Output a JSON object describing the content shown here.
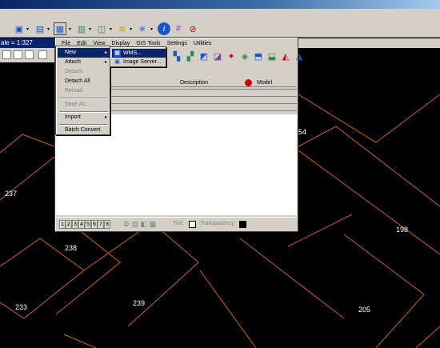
{
  "status": {
    "scale": "ale = 1:327"
  },
  "menubar": [
    "File",
    "Edit",
    "View",
    "Display",
    "GIS Tools",
    "Settings",
    "Utilities"
  ],
  "grid": {
    "col_description": "Description",
    "col_model": "Model"
  },
  "file_menu": {
    "items": [
      {
        "label": "New",
        "state": "selected",
        "submenu": true
      },
      {
        "label": "Attach",
        "state": "enabled",
        "submenu": true
      },
      {
        "label": "Detach",
        "state": "disabled"
      },
      {
        "label": "Detach All",
        "state": "enabled"
      },
      {
        "label": "Reload",
        "state": "disabled"
      },
      {
        "label": "Save As...",
        "state": "disabled"
      },
      {
        "label": "Import",
        "state": "enabled",
        "submenu": true
      },
      {
        "label": "Batch Convert",
        "state": "enabled"
      }
    ]
  },
  "new_submenu": {
    "items": [
      {
        "label": "WMS...",
        "icon": "wms-icon"
      },
      {
        "label": "Image Server...",
        "icon": "image-server-icon"
      }
    ]
  },
  "view_buttons": [
    "1",
    "2",
    "3",
    "4",
    "5",
    "6",
    "7",
    "8"
  ],
  "bottom": {
    "tint_label": "Tint:",
    "transparency_label": "Transparency:"
  },
  "map_labels": [
    "237",
    "238",
    "233",
    "239",
    "198",
    "205",
    "54"
  ],
  "colors": {
    "parcel_line": "#c8641e",
    "background": "#000000",
    "selection": "#0a246a"
  }
}
